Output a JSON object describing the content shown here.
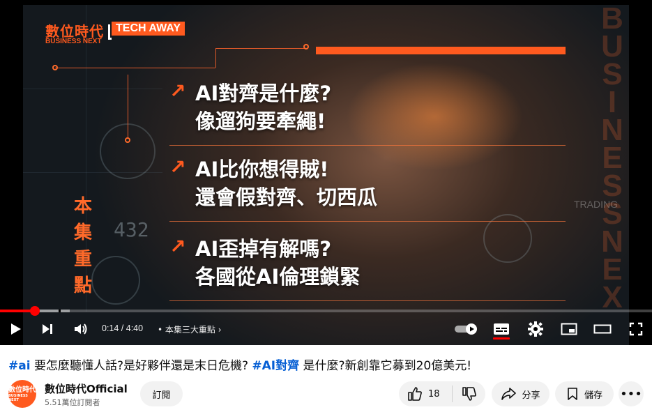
{
  "video": {
    "logo_cn": "數位時代",
    "logo_en": "BUSINESS NEXT",
    "series": "TECH AWAY",
    "vertical_title": [
      "本",
      "集",
      "重",
      "點"
    ],
    "headlines": [
      {
        "line1": "AI對齊是什麼?",
        "line2": "像遛狗要牽繩!"
      },
      {
        "line1": "AI比你想得賊!",
        "line2": "還會假對齊、切西瓜"
      },
      {
        "line1": "AI歪掉有解嗎?",
        "line2": "各國從AI倫理鎖緊"
      }
    ],
    "watermark": [
      "B",
      "U",
      "S",
      "I",
      "N",
      "E",
      "S",
      "S",
      "N",
      "E",
      "X"
    ],
    "hud_number": "432",
    "hud_text": "TRADING",
    "accent_color": "#ff5a1f"
  },
  "player": {
    "progress_fraction": 0.053,
    "time": "0:14 / 4:40",
    "chapter_label": "• 本集三大重點",
    "icons": [
      "play-icon",
      "next-icon",
      "volume-icon",
      "autoplay-toggle",
      "captions-icon",
      "settings-icon",
      "miniplayer-icon",
      "theater-icon",
      "fullscreen-icon"
    ]
  },
  "meta": {
    "title_parts": [
      {
        "text": "#ai",
        "tag": true
      },
      {
        "text": " 要怎麼聽懂人話?是好夥伴還是末日危機? ",
        "tag": false
      },
      {
        "text": "#AI對齊",
        "tag": true
      },
      {
        "text": " 是什麼?新創靠它募到20億美元!",
        "tag": false
      }
    ],
    "channel_avatar_text": "數位時代",
    "channel_avatar_sub": "BUSINESS NEXT",
    "channel_name": "數位時代Official",
    "subscribers": "5.51萬位訂閱者",
    "subscribe_label": "訂閱",
    "like_count": "18",
    "share_label": "分享",
    "save_label": "儲存"
  }
}
